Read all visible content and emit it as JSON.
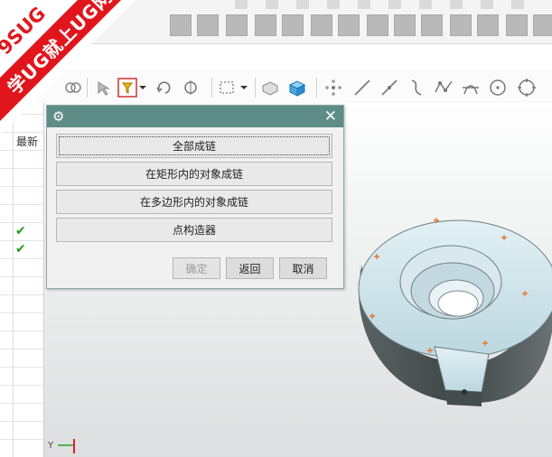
{
  "watermark": {
    "line1": "9SUG",
    "line2": "学UG就上UG网"
  },
  "navigator": {
    "column_header": "最新",
    "checks": [
      "✔",
      "✔"
    ]
  },
  "dialog": {
    "options": [
      {
        "label": "全部成链",
        "focused": true
      },
      {
        "label": "在矩形内的对象成链",
        "focused": false
      },
      {
        "label": "在多边形内的对象成链",
        "focused": false
      },
      {
        "label": "点构造器",
        "focused": false
      }
    ],
    "buttons": {
      "ok": "确定",
      "back": "返回",
      "cancel": "取消"
    }
  },
  "icons": {
    "dialog_settings": "gear-icon",
    "dialog_close": "close-icon"
  },
  "axis_label": "Y",
  "colors": {
    "dialog_title_bar": "#5e8c86",
    "part_face": "#cde3ea",
    "part_side": "#4b5354",
    "point_marker": "#e07a2e",
    "watermark": "#e0161c",
    "check": "#1aa01a"
  }
}
